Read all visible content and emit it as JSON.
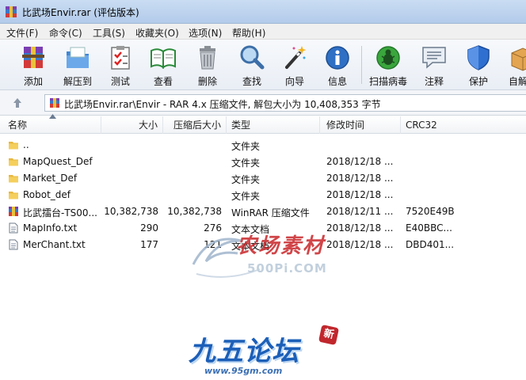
{
  "window": {
    "title": "比武场Envir.rar (评估版本)"
  },
  "menu": [
    {
      "label": "文件(F)"
    },
    {
      "label": "命令(C)"
    },
    {
      "label": "工具(S)"
    },
    {
      "label": "收藏夹(O)"
    },
    {
      "label": "选项(N)"
    },
    {
      "label": "帮助(H)"
    }
  ],
  "toolbar": [
    {
      "label": "添加",
      "icon": "add-archive-icon"
    },
    {
      "label": "解压到",
      "icon": "extract-to-icon"
    },
    {
      "label": "测试",
      "icon": "test-icon"
    },
    {
      "label": "查看",
      "icon": "view-book-icon"
    },
    {
      "label": "删除",
      "icon": "trash-icon"
    },
    {
      "label": "查找",
      "icon": "magnifier-icon"
    },
    {
      "label": "向导",
      "icon": "wizard-wand-icon"
    },
    {
      "label": "信息",
      "icon": "info-icon"
    },
    {
      "label": "扫描病毒",
      "icon": "virus-scan-icon"
    },
    {
      "label": "注释",
      "icon": "comment-icon"
    },
    {
      "label": "保护",
      "icon": "shield-icon"
    },
    {
      "label": "自解压",
      "icon": "sfx-box-icon"
    }
  ],
  "address": {
    "path": "比武场Envir.rar\\Envir - RAR 4.x 压缩文件, 解包大小为 10,408,353 字节"
  },
  "columns": {
    "name": "名称",
    "size": "大小",
    "packed": "压缩后大小",
    "type": "类型",
    "modified": "修改时间",
    "crc": "CRC32"
  },
  "files": [
    {
      "name": "..",
      "size": "",
      "packed": "",
      "type": "文件夹",
      "modified": "",
      "crc": "",
      "icon": "folder-icon"
    },
    {
      "name": "MapQuest_Def",
      "size": "",
      "packed": "",
      "type": "文件夹",
      "modified": "2018/12/18 ...",
      "crc": "",
      "icon": "folder-icon"
    },
    {
      "name": "Market_Def",
      "size": "",
      "packed": "",
      "type": "文件夹",
      "modified": "2018/12/18 ...",
      "crc": "",
      "icon": "folder-icon"
    },
    {
      "name": "Robot_def",
      "size": "",
      "packed": "",
      "type": "文件夹",
      "modified": "2018/12/18 ...",
      "crc": "",
      "icon": "folder-icon"
    },
    {
      "name": "比武擂台-TS00...",
      "size": "10,382,738",
      "packed": "10,382,738",
      "type": "WinRAR 压缩文件",
      "modified": "2018/12/11 ...",
      "crc": "7520E49B",
      "icon": "rar-file-icon"
    },
    {
      "name": "MapInfo.txt",
      "size": "290",
      "packed": "276",
      "type": "文本文档",
      "modified": "2018/12/18 ...",
      "crc": "E40BBC...",
      "icon": "text-file-icon"
    },
    {
      "name": "MerChant.txt",
      "size": "177",
      "packed": "121",
      "type": "文本文档",
      "modified": "2018/12/18 ...",
      "crc": "DBD401...",
      "icon": "text-file-icon"
    }
  ],
  "watermarks": {
    "top_text": "农场素材",
    "top_url": "500Pi.COM",
    "bottom_text": "九五论坛",
    "bottom_url": "www.95gm.com",
    "badge": "新"
  }
}
